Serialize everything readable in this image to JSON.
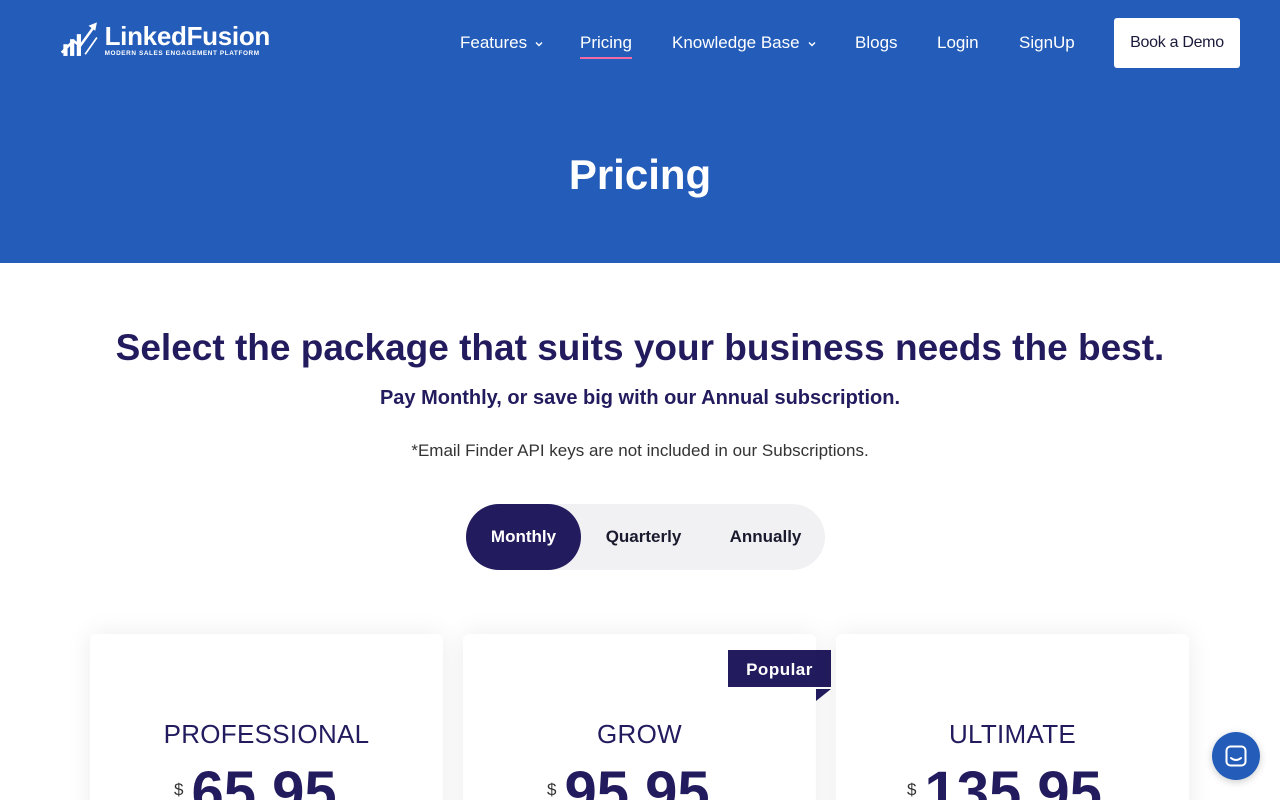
{
  "colors": {
    "hero_bg": "#235cb9",
    "brand_navy": "#221c5e",
    "nav_active_underline": "#f06aa3"
  },
  "logo": {
    "name": "LinkedFusion",
    "tagline": "MODERN SALES ENGAGEMENT PLATFORM",
    "icon": "logo-chart-arrow-icon"
  },
  "nav": {
    "items": [
      {
        "label": "Features",
        "has_dropdown": true
      },
      {
        "label": "Pricing",
        "active": true
      },
      {
        "label": "Knowledge Base",
        "has_dropdown": true
      },
      {
        "label": "Blogs"
      },
      {
        "label": "Login"
      },
      {
        "label": "SignUp"
      }
    ],
    "cta": "Book a Demo"
  },
  "hero": {
    "title": "Pricing"
  },
  "intro": {
    "headline": "Select the package that suits your business needs the best.",
    "subline": "Pay Monthly, or save big with our Annual subscription.",
    "note": "*Email Finder API keys are not included in our Subscriptions."
  },
  "billing_toggle": {
    "options": [
      "Monthly",
      "Quarterly",
      "Annually"
    ],
    "selected": "Monthly"
  },
  "plans": [
    {
      "name": "PROFESSIONAL",
      "currency": "$",
      "price": "65.95"
    },
    {
      "name": "GROW",
      "currency": "$",
      "price": "95.95",
      "badge": "Popular"
    },
    {
      "name": "ULTIMATE",
      "currency": "$",
      "price": "135.95"
    }
  ],
  "chat_widget": {
    "icon": "chat-bubble-icon"
  }
}
